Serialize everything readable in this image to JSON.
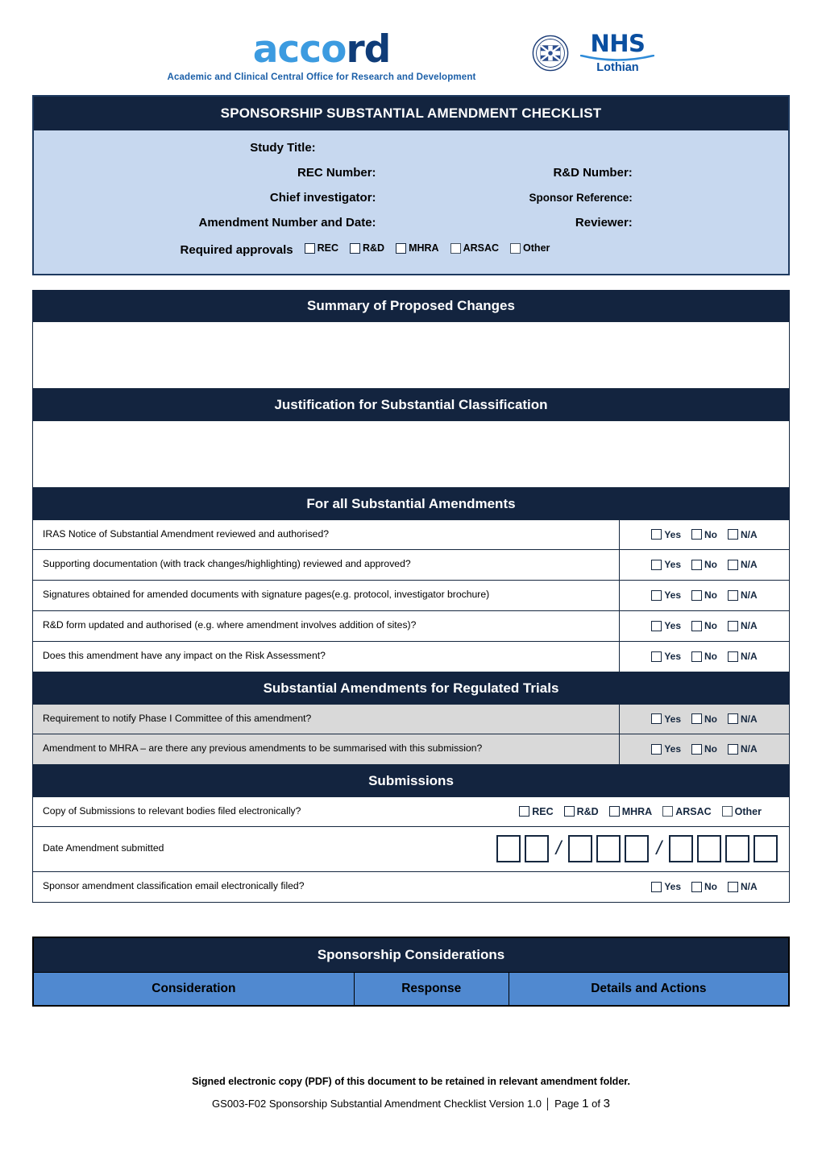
{
  "logo": {
    "accord_light": "acco",
    "accord_dark": "rd",
    "accord_tagline": "Academic and Clinical Central Office for Research and Development",
    "nhs_text": "NHS",
    "nhs_region": "Lothian",
    "crest_name": "university-of-edinburgh-crest"
  },
  "header": {
    "title": "SPONSORSHIP SUBSTANTIAL AMENDMENT CHECKLIST",
    "fields": {
      "study_title": "Study Title:",
      "rec_number": "REC Number:",
      "rd_number": "R&D Number:",
      "chief_investigator": "Chief investigator:",
      "sponsor_reference": "Sponsor Reference:",
      "amendment_number_date": "Amendment Number and Date:",
      "reviewer": "Reviewer:",
      "required_approvals": "Required approvals"
    },
    "approval_options": [
      "REC",
      "R&D",
      "MHRA",
      "ARSAC",
      "Other"
    ]
  },
  "sections": {
    "summary": {
      "heading": "Summary of Proposed Changes"
    },
    "justification": {
      "heading": "Justification for Substantial Classification"
    },
    "all_substantial": {
      "heading": "For all Substantial Amendments",
      "rows": [
        "IRAS Notice of Substantial Amendment reviewed and authorised?",
        "Supporting documentation (with track changes/highlighting) reviewed and approved?",
        "Signatures obtained for amended documents with signature pages(e.g. protocol, investigator brochure)",
        "R&D form updated and authorised (e.g. where amendment involves addition of sites)?",
        "Does this amendment have any impact on the Risk Assessment?"
      ]
    },
    "regulated": {
      "heading": "Substantial Amendments for Regulated Trials",
      "rows": [
        "Requirement to notify Phase I Committee of this amendment?",
        "Amendment to MHRA – are there any previous amendments to be summarised with this submission?"
      ]
    },
    "submissions": {
      "heading": "Submissions",
      "copy_row_label": "Copy of Submissions to relevant bodies filed electronically?",
      "copy_row_options": [
        "REC",
        "R&D",
        "MHRA",
        "ARSAC",
        "Other"
      ],
      "date_row_label": "Date Amendment submitted",
      "date_separator": "/",
      "date_group_counts": [
        2,
        3,
        4
      ],
      "email_row_label": "Sponsor amendment classification email electronically filed?"
    },
    "considerations": {
      "heading": "Sponsorship Considerations",
      "columns": [
        "Consideration",
        "Response",
        "Details and Actions"
      ]
    }
  },
  "answer_options": [
    "Yes",
    "No",
    "N/A"
  ],
  "footer": {
    "note": "Signed electronic copy (PDF) of this document to be retained in relevant amendment folder.",
    "doc_ref": "GS003-F02 Sponsorship Substantial Amendment Checklist Version 1.0",
    "separator": "│",
    "page_word": "Page",
    "page_number": "1",
    "of_word": "of",
    "page_total": "3"
  },
  "colors": {
    "navy": "#13243F",
    "light_blue_panel": "#C7D8EF",
    "accent_blue": "#5089D0",
    "grey_row": "#D9D9D9",
    "accord_light": "#3C9BE0",
    "accord_dark": "#0F3C78",
    "nhs_blue": "#0A4FA0"
  }
}
